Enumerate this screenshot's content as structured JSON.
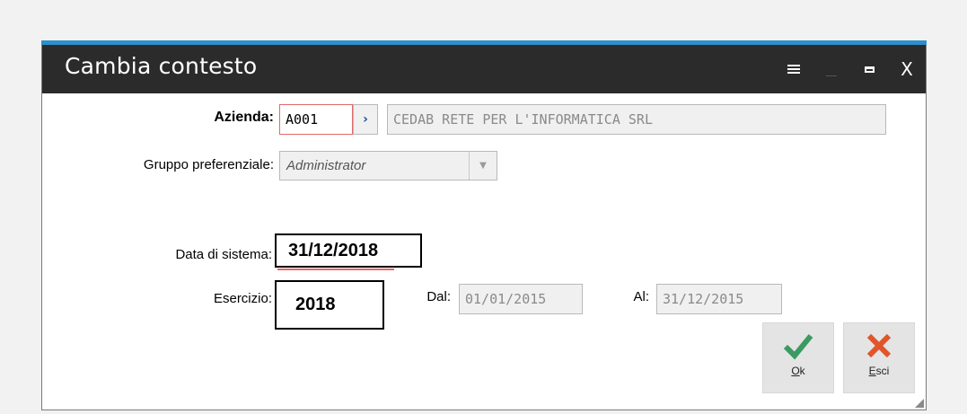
{
  "window": {
    "title": "Cambia contesto",
    "controls": {
      "menu_icon": "hamburger-menu-icon",
      "minimize_icon": "minimize-icon",
      "maximize_icon": "maximize-icon",
      "close_glyph": "X"
    },
    "accent_color": "#2c8fcb",
    "titlebar_color": "#2b2b2b"
  },
  "form": {
    "azienda": {
      "label": "Azienda:",
      "code": "A001",
      "zoom_icon": "chevron-right-icon",
      "description": "CEDAB RETE PER L'INFORMATICA SRL"
    },
    "gruppo": {
      "label": "Gruppo preferenziale:",
      "value": "Administrator"
    },
    "data_sistema": {
      "label": "Data di sistema:",
      "value": "31/12/2018"
    },
    "esercizio": {
      "label": "Esercizio:",
      "value": "2018"
    },
    "dal": {
      "label": "Dal:",
      "value": "01/01/2015"
    },
    "al": {
      "label": "Al:",
      "value": "31/12/2015"
    }
  },
  "buttons": {
    "ok": {
      "label_underlined": "O",
      "label_rest": "k",
      "icon": "checkmark-icon",
      "color": "#3a9a62"
    },
    "esci": {
      "label_underlined": "E",
      "label_rest": "sci",
      "icon": "cross-icon",
      "color": "#e0552a"
    }
  }
}
